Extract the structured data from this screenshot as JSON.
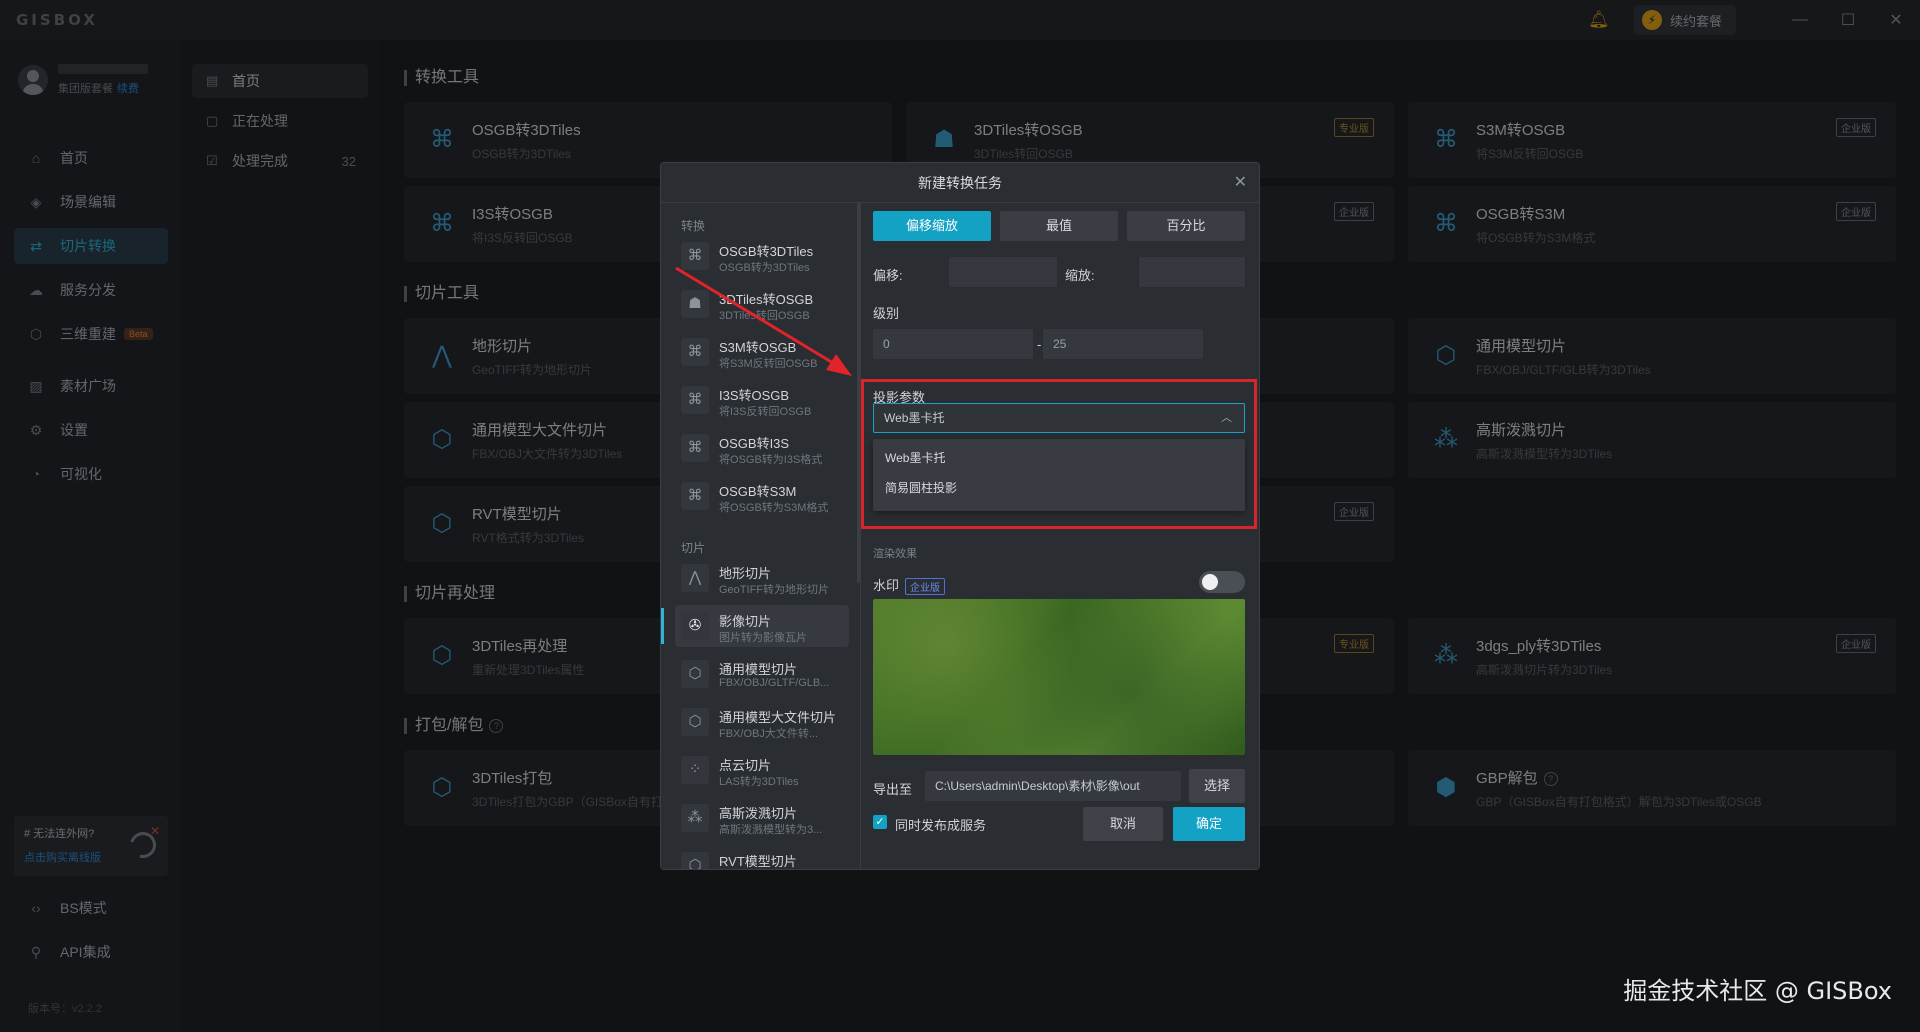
{
  "app": {
    "logo": "GISBOX",
    "renew_label": "续约套餐",
    "version": "版本号：v2.2.2",
    "watermark": "掘金技术社区 @ GISBox"
  },
  "user": {
    "plan": "集团版套餐",
    "renew_link": "续费"
  },
  "leftnav": {
    "items": [
      {
        "label": "首页",
        "icon": "home-icon"
      },
      {
        "label": "场景编辑",
        "icon": "cube-icon"
      },
      {
        "label": "切片转换",
        "icon": "convert-icon"
      },
      {
        "label": "服务分发",
        "icon": "cloud-icon"
      },
      {
        "label": "三维重建",
        "icon": "reconstruct-icon",
        "badge": "Beta"
      },
      {
        "label": "素材广场",
        "icon": "image-icon"
      },
      {
        "label": "设置",
        "icon": "gear-icon"
      },
      {
        "label": "可视化",
        "icon": "chart-icon"
      }
    ],
    "active": "切片转换",
    "offline": {
      "title": "# 无法连外网?",
      "link": "点击购买离线版"
    },
    "bottom": [
      {
        "label": "BS模式",
        "icon": "code-icon"
      },
      {
        "label": "API集成",
        "icon": "api-icon"
      }
    ]
  },
  "subnav": {
    "items": [
      {
        "label": "首页",
        "icon": "home-icon"
      },
      {
        "label": "正在处理",
        "icon": "doc-icon"
      },
      {
        "label": "处理完成",
        "icon": "check-doc-icon",
        "count": "32"
      }
    ]
  },
  "sections": [
    {
      "title": "转换工具"
    },
    {
      "title": "切片工具"
    },
    {
      "title": "切片再处理"
    },
    {
      "title": "打包/解包"
    }
  ],
  "cards": [
    {
      "title": "OSGB转3DTiles",
      "sub": "OSGB转为3DTiles",
      "badge": ""
    },
    {
      "title": "3DTiles转OSGB",
      "sub": "3DTiles转回OSGB",
      "badge": "专业版"
    },
    {
      "title": "S3M转OSGB",
      "sub": "将S3M反转回OSGB",
      "badge": "企业版"
    },
    {
      "title": "I3S转OSGB",
      "sub": "将I3S反转回OSGB",
      "badge": ""
    },
    {
      "title": "",
      "sub": "",
      "badge": "企业版"
    },
    {
      "title": "OSGB转S3M",
      "sub": "将OSGB转为S3M格式",
      "badge": "企业版"
    },
    {
      "title": "地形切片",
      "sub": "GeoTIFF转为地形切片",
      "badge": ""
    },
    {
      "title": "通用模型切片",
      "sub": "FBX/OBJ/GLTF/GLB转为3DTiles",
      "badge": ""
    },
    {
      "title": "通用模型大文件切片",
      "sub": "FBX/OBJ大文件转为3DTiles",
      "badge": ""
    },
    {
      "title": "高斯泼溅切片",
      "sub": "高斯泼溅模型转为3DTiles",
      "badge": ""
    },
    {
      "title": "RVT模型切片",
      "sub": "RVT格式转为3DTiles",
      "badge": ""
    },
    {
      "title": "",
      "sub": "",
      "badge": "企业版"
    },
    {
      "title": "3DTiles再处理",
      "sub": "重新处理3DTiles属性",
      "badge": ""
    },
    {
      "title": "",
      "sub": "",
      "badge": "专业版"
    },
    {
      "title": "3dgs_ply转3DTiles",
      "sub": "高斯泼溅切片转为3DTiles",
      "badge": "企业版"
    },
    {
      "title": "3DTiles打包",
      "sub": "3DTiles打包为GBP（GISBox自有打",
      "badge": ""
    },
    {
      "title": "GBP解包",
      "sub": "GBP（GISBox自有打包格式）解包为3DTiles或OSGB",
      "badge": ""
    }
  ],
  "dialog": {
    "title": "新建转换任务",
    "group_convert": "转换",
    "group_slice": "切片",
    "items": [
      {
        "title": "OSGB转3DTiles",
        "sub": "OSGB转为3DTiles"
      },
      {
        "title": "3DTiles转OSGB",
        "sub": "3DTiles转回OSGB"
      },
      {
        "title": "S3M转OSGB",
        "sub": "将S3M反转回OSGB"
      },
      {
        "title": "I3S转OSGB",
        "sub": "将I3S反转回OSGB"
      },
      {
        "title": "OSGB转I3S",
        "sub": "将OSGB转为I3S格式"
      },
      {
        "title": "OSGB转S3M",
        "sub": "将OSGB转为S3M格式"
      },
      {
        "title": "地形切片",
        "sub": "GeoTIFF转为地形切片"
      },
      {
        "title": "影像切片",
        "sub": "图片转为影像瓦片"
      },
      {
        "title": "通用模型切片",
        "sub": "FBX/OBJ/GLTF/GLB..."
      },
      {
        "title": "通用模型大文件切片",
        "sub": "FBX/OBJ大文件转..."
      },
      {
        "title": "点云切片",
        "sub": "LAS转为3DTiles"
      },
      {
        "title": "高斯泼溅切片",
        "sub": "高斯泼溅模型转为3..."
      },
      {
        "title": "RVT模型切片",
        "sub": ""
      }
    ],
    "tabs": [
      "偏移缩放",
      "最值",
      "百分比"
    ],
    "offset_label": "偏移:",
    "scale_label": "缩放:",
    "level_label": "级别",
    "level_min": "0",
    "level_max": "25",
    "level_sep": "-",
    "projection_label": "投影参数",
    "projection_value": "Web墨卡托",
    "projection_options": [
      "Web墨卡托",
      "简易圆柱投影"
    ],
    "render_label": "渲染效果",
    "watermark_label": "水印",
    "enterprise_badge": "企业版",
    "export_label": "导出至",
    "export_path": "C:\\Users\\admin\\Desktop\\素材\\影像\\out",
    "choose_label": "选择",
    "publish_label": "同时发布成服务",
    "cancel_label": "取消",
    "confirm_label": "确定"
  },
  "colors": {
    "accent": "#13a1c4",
    "highlight_box": "#d8242a",
    "arrow": "#e0242a"
  }
}
